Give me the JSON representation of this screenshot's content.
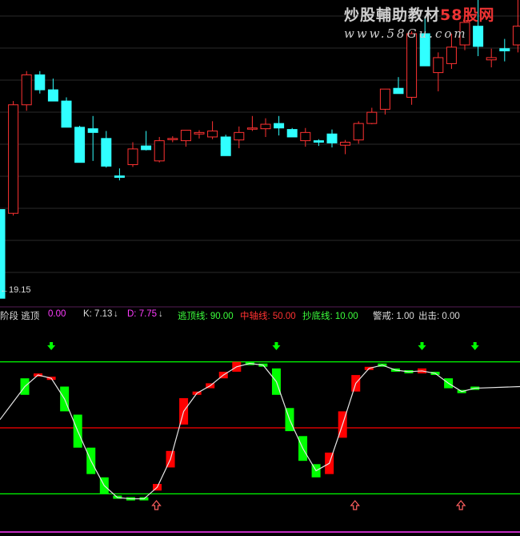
{
  "watermark": {
    "brand_part1": "炒股輔助教材",
    "brand_part2": "58股网",
    "url": "www.58Gu.com"
  },
  "price_axis_label": "←19.15",
  "indicator_legend": {
    "name": "阶段 逃顶",
    "name_value": "0.00",
    "k_label": "K: 7.13",
    "k_arrow": "↓",
    "d_label": "D: 7.75",
    "d_arrow": "↓",
    "escape_line": "逃顶线: 90.00",
    "middle_line": "中轴线: 50.00",
    "bottom_line": "抄底线: 10.00",
    "warning": "警戒: 1.00",
    "exit": "出击: 0.00"
  },
  "colors": {
    "up": "#ff3232",
    "down": "#30ffff",
    "ind_up": "#ff0000",
    "ind_down": "#00ff00",
    "ma_line": "#e6e6e6",
    "grid": "#2a2a2a",
    "escape_line": "#00ff00",
    "middle_line": "#ff0000",
    "bottom_line": "#00ff00",
    "border": "#ff3cff",
    "sell_arrow": "#00ff00",
    "buy_arrow": "#ff6060"
  },
  "chart_data": [
    {
      "type": "candlestick",
      "x": [
        0,
        1,
        2,
        3,
        4,
        5,
        6,
        7,
        8,
        9,
        10,
        11,
        12,
        13,
        14,
        15,
        16,
        17,
        18,
        19,
        20,
        21,
        22,
        23,
        24,
        25,
        26,
        27,
        28,
        29,
        30,
        31,
        32,
        33,
        34,
        35,
        36,
        37,
        38,
        39
      ],
      "ohlc": [
        [
          31,
          31,
          19.15,
          19.15
        ],
        [
          30.5,
          45.5,
          30.2,
          45
        ],
        [
          45,
          49.5,
          44.2,
          49
        ],
        [
          49,
          49.5,
          46.5,
          47
        ],
        [
          47,
          48.5,
          45.5,
          45.5
        ],
        [
          45.5,
          46,
          42,
          42
        ],
        [
          42,
          42.2,
          37.3,
          37.3
        ],
        [
          41.8,
          43.5,
          37.5,
          41.3
        ],
        [
          40.5,
          41.5,
          36.6,
          36.8
        ],
        [
          35.5,
          36.5,
          34.9,
          35.3
        ],
        [
          37,
          40,
          36.7,
          39.1
        ],
        [
          39.5,
          41.5,
          38.9,
          39
        ],
        [
          37.5,
          40.7,
          37.3,
          40.2
        ],
        [
          40.5,
          40.8,
          40,
          40.5
        ],
        [
          40.2,
          41.6,
          39.4,
          41.6
        ],
        [
          41.1,
          41.6,
          40.5,
          41.3
        ],
        [
          40.7,
          42.8,
          40.4,
          41.5
        ],
        [
          40.7,
          41,
          38.2,
          38.2
        ],
        [
          40.3,
          42.1,
          39.2,
          41.3
        ],
        [
          41.9,
          43.5,
          41.5,
          41.9
        ],
        [
          41.8,
          43.2,
          40.7,
          42.4
        ],
        [
          42.5,
          43.5,
          40.9,
          41.9
        ],
        [
          41.7,
          41.9,
          40.8,
          40.7
        ],
        [
          40.2,
          41.9,
          39.4,
          41.3
        ],
        [
          40.2,
          40.4,
          39.5,
          40
        ],
        [
          41.1,
          41.7,
          39.3,
          39.9
        ],
        [
          39.6,
          40.3,
          38.4,
          40.0
        ],
        [
          40.3,
          42.8,
          39.8,
          42.5
        ],
        [
          42.5,
          44.6,
          42.4,
          44.0
        ],
        [
          44.4,
          47.1,
          43.7,
          47.1
        ],
        [
          47.2,
          48.7,
          46.5,
          46.5
        ],
        [
          46,
          54.8,
          45,
          54.5
        ],
        [
          54.5,
          56.8,
          51.6,
          50.2
        ],
        [
          49.3,
          52,
          46.8,
          51.3
        ],
        [
          50.5,
          54.5,
          49.8,
          52.7
        ],
        [
          53,
          57,
          52.3,
          56
        ],
        [
          55.5,
          59,
          51.5,
          52.8
        ],
        [
          51,
          52.5,
          50,
          51.3
        ],
        [
          52.5,
          53.8,
          50.8,
          52.2
        ],
        [
          53,
          59,
          52,
          55.5
        ]
      ],
      "ylim": [
        18,
        59
      ]
    },
    {
      "type": "bar",
      "categories": [
        0,
        1,
        2,
        3,
        4,
        5,
        6,
        7,
        8,
        9,
        10,
        11,
        12,
        13,
        14,
        15,
        16,
        17,
        18,
        19,
        20,
        21,
        22,
        23,
        24,
        25,
        26,
        27,
        28,
        29,
        30,
        31,
        32,
        33,
        34,
        35,
        36,
        37,
        38,
        39
      ],
      "series": [
        {
          "values": [
            [
              70,
              80
            ],
            [
              82,
              82
            ],
            [
              80,
              80
            ],
            [
              75,
              60
            ],
            [
              58,
              38
            ],
            [
              38,
              22
            ],
            [
              20,
              10
            ],
            [
              8,
              7.5
            ],
            [
              8,
              6
            ],
            [
              7,
              7
            ],
            [
              12,
              16
            ],
            [
              26,
              36
            ],
            [
              52,
              68
            ],
            [
              70,
              72
            ],
            [
              74,
              77
            ],
            [
              80,
              84
            ],
            [
              84,
              90
            ],
            [
              90,
              88
            ],
            [
              88,
              88
            ],
            [
              86,
              70
            ],
            [
              62,
              48
            ],
            [
              45,
              30
            ],
            [
              28,
              20
            ],
            [
              22,
              35
            ],
            [
              44,
              60
            ],
            [
              72,
              82
            ],
            [
              86,
              86
            ],
            [
              88,
              88
            ],
            [
              86,
              84
            ],
            [
              84,
              84
            ],
            [
              86,
              83
            ],
            [
              83,
              83
            ],
            [
              80,
              74
            ],
            [
              72,
              72
            ],
            [
              75,
              73
            ]
          ]
        },
        {
          "values": [
            [
              0,
              1,
              1,
              0,
              0,
              0,
              0,
              0,
              0,
              0,
              1,
              1,
              1,
              1,
              1,
              1,
              1,
              0,
              0,
              0,
              0,
              0,
              0,
              1,
              1,
              1,
              1,
              0,
              0,
              0,
              1,
              0,
              0,
              0,
              0
            ]
          ]
        }
      ],
      "ylim": [
        0,
        100
      ],
      "reference_lines": [
        90,
        50,
        10
      ]
    }
  ]
}
